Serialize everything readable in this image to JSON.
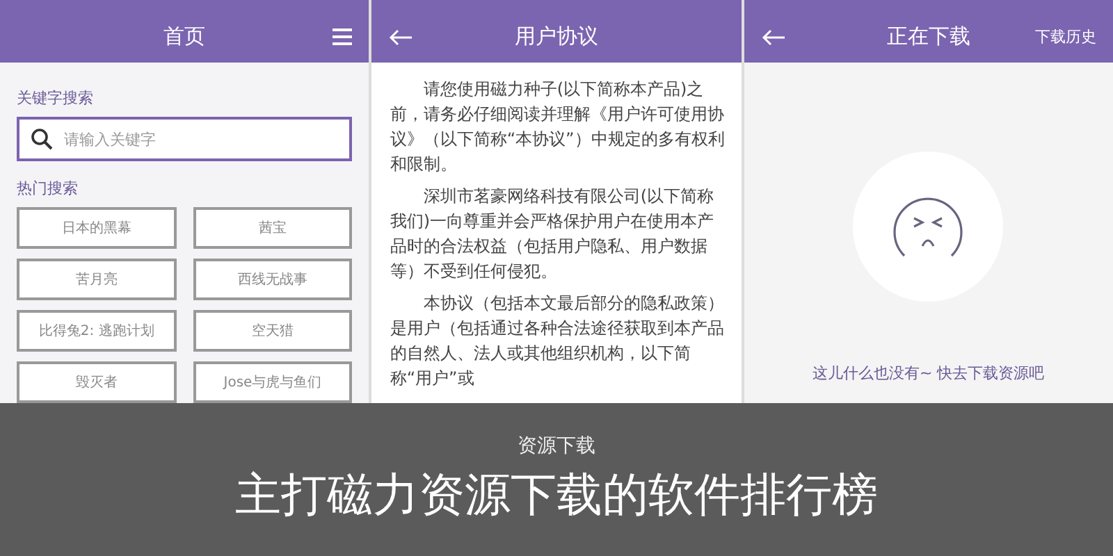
{
  "screens": [
    {
      "kind": "home",
      "title": "首页",
      "search_label": "关键字搜索",
      "search": {
        "placeholder": "请输入关键字"
      },
      "hot_label": "热门搜索",
      "hot_items": [
        "日本的黑幕",
        "茜宝",
        "苦月亮",
        "西线无战事",
        "比得兔2: 逃跑计划",
        "空天猎",
        "毁灭者",
        "Jose与虎与鱼们"
      ]
    },
    {
      "kind": "agreement",
      "title": "用户协议",
      "paragraphs": [
        "请您使用磁力种子(以下简称本产品)之前，请务必仔细阅读并理解《用户许可使用协议》（以下简称“本协议”）中规定的多有权利和限制。",
        "深圳市茗豪网络科技有限公司(以下简称我们)一向尊重并会严格保护用户在使用本产品时的合法权益（包括用户隐私、用户数据等）不受到任何侵犯。",
        "本协议（包括本文最后部分的隐私政策）是用户（包括通过各种合法途径获取到本产品的自然人、法人或其他组织机构，以下简称“用户”或"
      ]
    },
    {
      "kind": "downloads",
      "title": "正在下载",
      "action": "下载历史",
      "empty_message": "这儿什么也没有~ 快去下载资源吧"
    }
  ],
  "banner": {
    "subtitle": "资源下载",
    "title": "主打磁力资源下载的软件排行榜"
  }
}
